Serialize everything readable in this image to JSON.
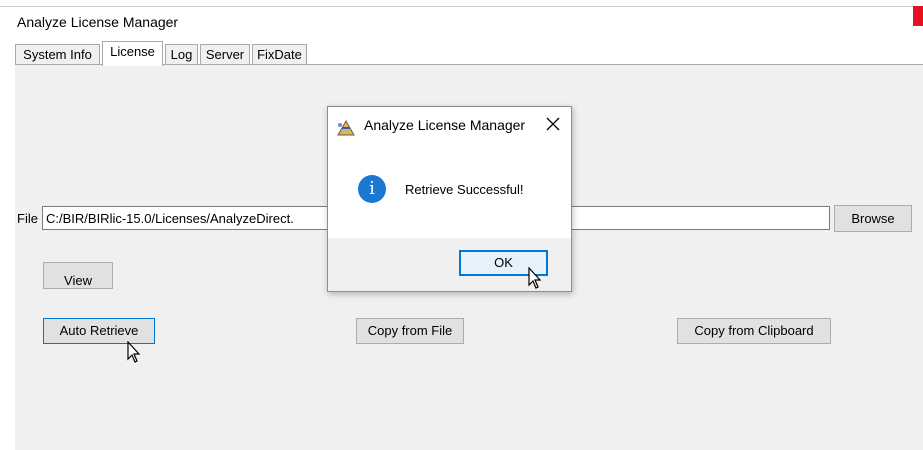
{
  "window": {
    "title": "Analyze License Manager"
  },
  "tabs": [
    {
      "label": "System Info",
      "active": false
    },
    {
      "label": "License",
      "active": true
    },
    {
      "label": "Log",
      "active": false
    },
    {
      "label": "Server",
      "active": false
    },
    {
      "label": "FixDate",
      "active": false
    }
  ],
  "license": {
    "file_label": "File",
    "file_value": "C:/BIR/BIRlic-15.0/Licenses/AnalyzeDirect.",
    "browse_label": "Browse",
    "view_label": "View",
    "auto_retrieve_label": "Auto Retrieve",
    "copy_from_file_label": "Copy from File",
    "copy_from_clipboard_label": "Copy from Clipboard"
  },
  "dialog": {
    "title": "Analyze License Manager",
    "message": "Retrieve Successful!",
    "ok_label": "OK",
    "icon": "info-icon"
  },
  "colors": {
    "accent": "#0078d7",
    "info_icon": "#1a78d2",
    "panel_bg": "#f0f0f0",
    "close_red": "#e81123"
  }
}
